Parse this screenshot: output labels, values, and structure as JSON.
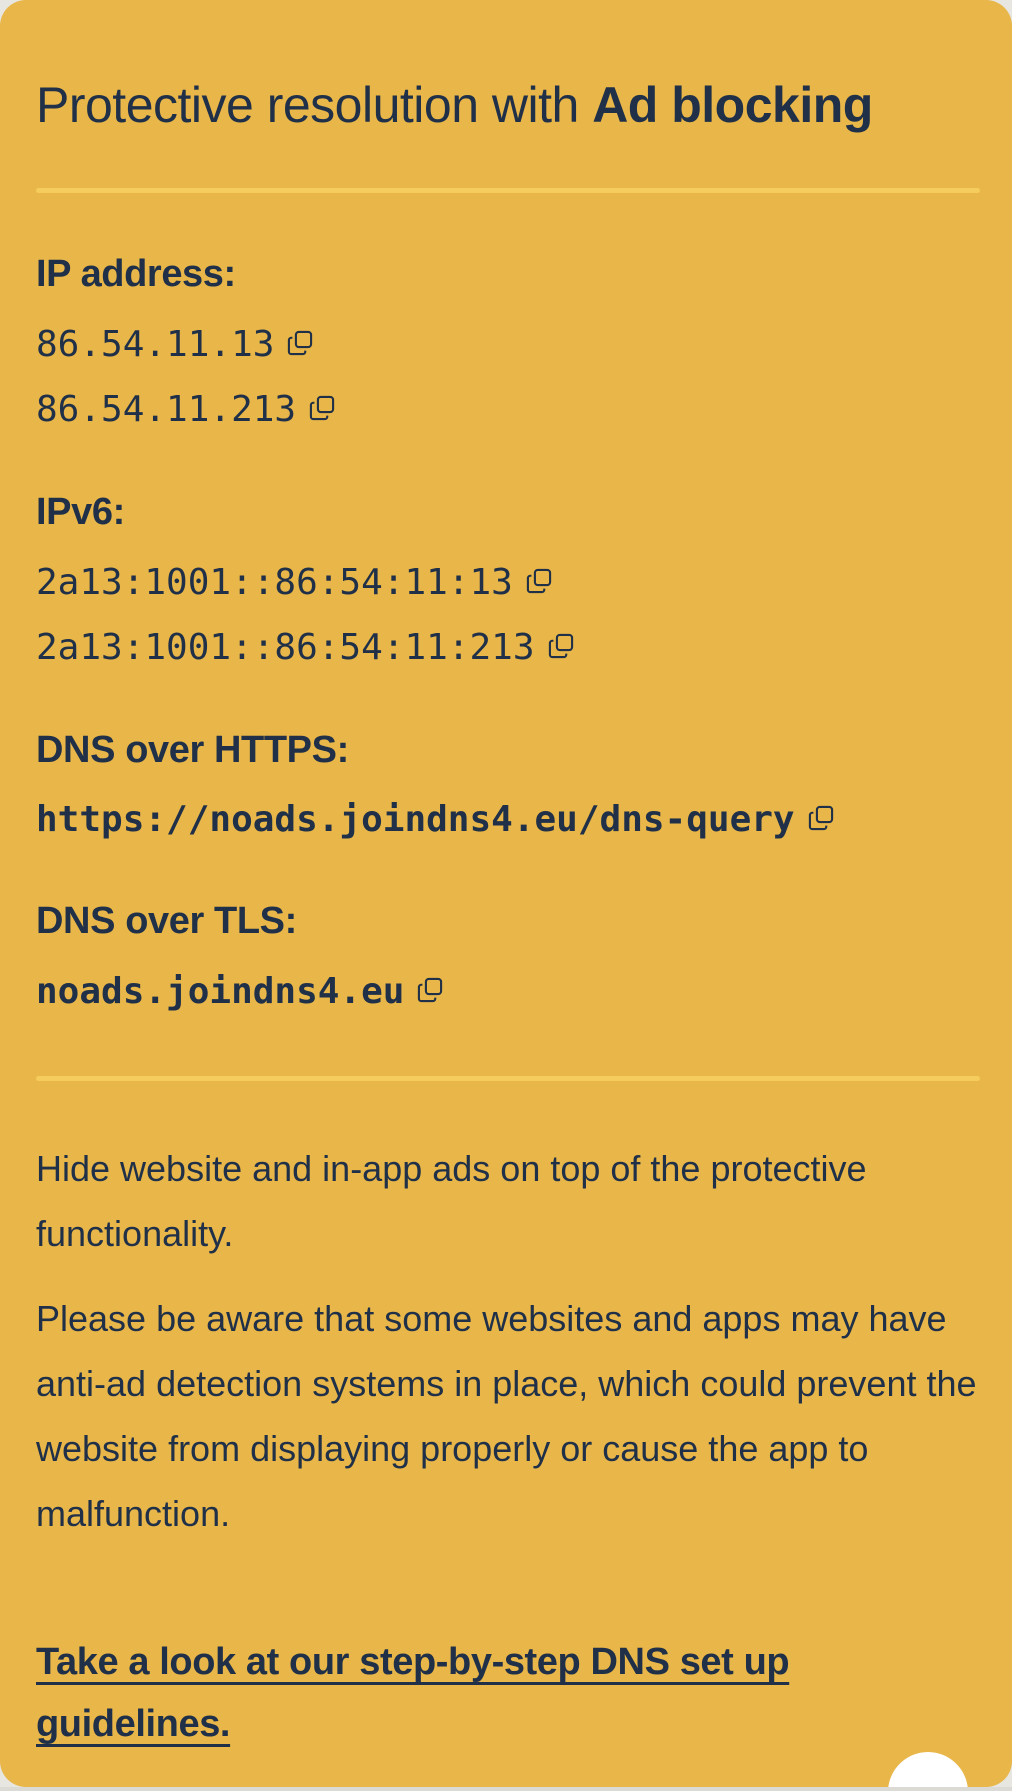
{
  "title": {
    "regular": "Protective resolution with ",
    "bold": "Ad blocking"
  },
  "sections": {
    "ip_address": {
      "label": "IP address:",
      "values": [
        "86.54.11.13",
        "86.54.11.213"
      ]
    },
    "ipv6": {
      "label": "IPv6:",
      "values": [
        "2a13:1001::86:54:11:13",
        "2a13:1001::86:54:11:213"
      ]
    },
    "doh": {
      "label": "DNS over HTTPS:",
      "values": [
        "https://noads.joindns4.eu/dns-query"
      ]
    },
    "dot": {
      "label": "DNS over TLS:",
      "values": [
        "noads.joindns4.eu"
      ]
    }
  },
  "description": {
    "paragraph1": "Hide website and in-app ads on top of the protective functionality.",
    "paragraph2": "Please be aware that some websites and apps may have anti-ad detection systems in place, which could prevent the website from displaying properly or cause the app to malfunction."
  },
  "link": {
    "text": "Take a look at our step-by-step DNS set up guidelines."
  },
  "icons": {
    "copy": "copy-icon"
  },
  "colors": {
    "card_background": "#e8b649",
    "divider": "#f7cc5e",
    "text": "#1f3048"
  }
}
